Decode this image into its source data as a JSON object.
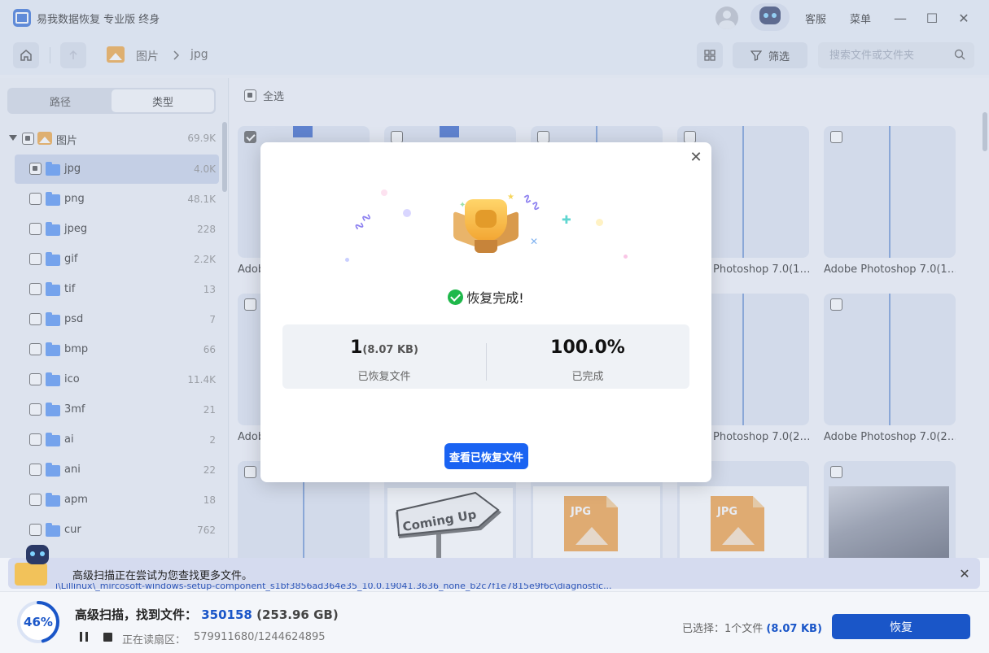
{
  "titlebar": {
    "app_title": "易我数据恢复 专业版 终身",
    "support": "客服",
    "menu": "菜单",
    "minimize": "—",
    "maximize": "☐",
    "close": "✕"
  },
  "toolbar": {
    "breadcrumb": [
      "图片",
      "jpg"
    ],
    "filter_label": "筛选",
    "search_placeholder": "搜索文件或文件夹"
  },
  "sidebar": {
    "tabs": [
      {
        "label": "路径",
        "active": false
      },
      {
        "label": "类型",
        "active": true
      }
    ],
    "root": {
      "label": "图片",
      "count": "69.9K"
    },
    "items": [
      {
        "label": "jpg",
        "count": "4.0K",
        "selected": true
      },
      {
        "label": "png",
        "count": "48.1K"
      },
      {
        "label": "jpeg",
        "count": "228"
      },
      {
        "label": "gif",
        "count": "2.2K"
      },
      {
        "label": "tif",
        "count": "13"
      },
      {
        "label": "psd",
        "count": "7"
      },
      {
        "label": "bmp",
        "count": "66"
      },
      {
        "label": "ico",
        "count": "11.4K"
      },
      {
        "label": "3mf",
        "count": "21"
      },
      {
        "label": "ai",
        "count": "2"
      },
      {
        "label": "ani",
        "count": "22"
      },
      {
        "label": "apm",
        "count": "18"
      },
      {
        "label": "cur",
        "count": "762"
      }
    ]
  },
  "main": {
    "select_all": "全选",
    "captions": {
      "r1c1": "Adob",
      "r1c4": "Photoshop 7.0(1…",
      "r1c5": "Adobe Photoshop 7.0(1…",
      "r2c1": "Adob",
      "r2c4": "Photoshop 7.0(2…",
      "r2c5": "Adobe Photoshop 7.0(2…"
    },
    "jpg_badge": "JPG",
    "sign_text": "Coming Up"
  },
  "modal": {
    "title": "恢复完成!",
    "recovered_count": "1",
    "recovered_size": "(8.07 KB)",
    "recovered_label": "已恢复文件",
    "percent": "100.0%",
    "percent_label": "已完成",
    "view_button": "查看已恢复文件"
  },
  "notice": {
    "text": "高级扫描正在尝试为您查找更多文件。",
    "path_fragment": "i\\Lillinux\\_mircosoft-windows-setup-component_s1bf3856ad364e35_10.0.19041.3636_none_b2c7f1e7815e9f6c\\diagnostic..."
  },
  "status": {
    "progress": 0.46,
    "progress_text": "46%",
    "scan_title": "高级扫描，找到文件：",
    "scan_count": "350158",
    "scan_size": "(253.96 GB)",
    "sector_label": "正在读扇区：",
    "sector_value": "579911680/1244624895",
    "selected_prefix": "已选择：1个文件",
    "selected_size": "(8.07 KB)",
    "recover_button": "恢复"
  },
  "colors": {
    "accent": "#1a56c8",
    "button_blue": "#1a63f2",
    "success_green": "#1fb84b",
    "folder_blue": "#4f8ff5",
    "image_orange": "#f0a136"
  }
}
